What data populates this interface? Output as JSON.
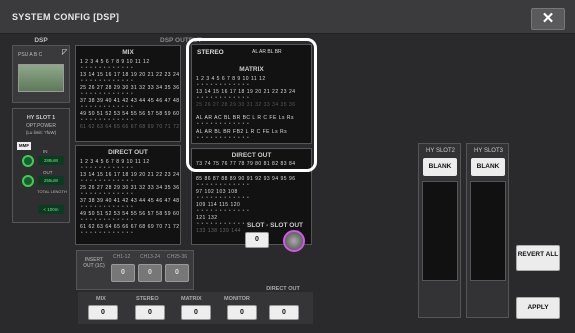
{
  "window": {
    "title": "SYSTEM CONFIG [DSP]"
  },
  "dsp": {
    "label": "DSP",
    "leds": "PSU A B C",
    "output_label": "DSP OUTPUT"
  },
  "hy_slot1": {
    "title": "HY SLOT 1",
    "opt_power": "OPT.POWER",
    "lu_limit": "(Lu limit: ?fuW)",
    "mmf": "MMF",
    "in_label": "IN",
    "in_value": "288uW",
    "out_label": "OUT",
    "out_value": "255uW",
    "total_label": "TOTAL LENGTH",
    "total_value": "< 100m"
  },
  "mix": {
    "title": "MIX",
    "rows": [
      "1  2  3  4  5  6  7  8  9  10 11 12",
      "13 14 15 16 17 18 19 20 21 22 23 24",
      "25 26 27 28 29 30 31 32 33 34 35 36",
      "37 38 39 40 41 42 43 44 45 46 47 48",
      "49 50 51 52 53 54 55 56 57 58 59 60",
      "61 62 63 64 65 66 67 68 69 70 71 72"
    ]
  },
  "stereo": {
    "title": "STEREO",
    "channels": "AL AR BL BR"
  },
  "matrix": {
    "title": "MATRIX",
    "rows": [
      "1  2  3  4  5  6  7  8  9  10 11 12",
      "13 14 15 16 17 18 19 20 21 22 23 24",
      "25 26 27 28 29 30 31 32 33 34 35 36",
      "AL AR AC BL BR BC  L  R  C  FE Ls Rs",
      "AL AR BL BR FB2  L  R  C  FE Ls Rs"
    ]
  },
  "direct_out": {
    "title": "DIRECT OUT",
    "rows": [
      "1  2  3  4  5  6  7  8  9  10 11 12",
      "13 14 15 16 17 18 19 20 21 22 23 24",
      "25 26 27 28 29 30 31 32 33 34 35 36",
      "37 38 39 40 41 42 43 44 45 46 47 48",
      "49 50 51 52 53 54 55 56 57 58 59 60",
      "61 62 63 64 65 66 67 68 69 70 71 72"
    ],
    "rows2": [
      "73 74 75 76 77 78 79 80 81 82 83 84",
      "85 86 87 88 89 90 91 92 93 94 95 96",
      "97                 102 103          108",
      "109            114 115              120",
      "121                                 132",
      "133               138 139          144"
    ]
  },
  "insert": {
    "label": "INSERT OUT (1C)",
    "ch1_12": "CH1-12",
    "ch13_24": "CH13-24",
    "ch25_36": "CH25-36",
    "ch1_12_val": "0",
    "ch13_24_val": "0",
    "ch25_36_val": "0"
  },
  "slot_out": {
    "label": "SLOT - SLOT OUT",
    "value": "0"
  },
  "bottom": {
    "mix_label": "MIX",
    "mix_val": "0",
    "stereo_label": "STEREO",
    "stereo_val": "0",
    "matrix_label": "MATRIX",
    "matrix_val": "0",
    "monitor_label": "MONITOR",
    "monitor_val": "0",
    "direct_label": "DIRECT OUT",
    "direct_val": "0"
  },
  "hy_slot2": {
    "title": "HY SLOT2",
    "value": "BLANK"
  },
  "hy_slot3": {
    "title": "HY SLOT3",
    "value": "BLANK"
  },
  "buttons": {
    "revert_all": "REVERT ALL",
    "apply": "APPLY"
  },
  "colors": {
    "accent_highlight": "#ffffff",
    "knob_ring": "#d259e8",
    "led_green": "#3ccf4e"
  }
}
